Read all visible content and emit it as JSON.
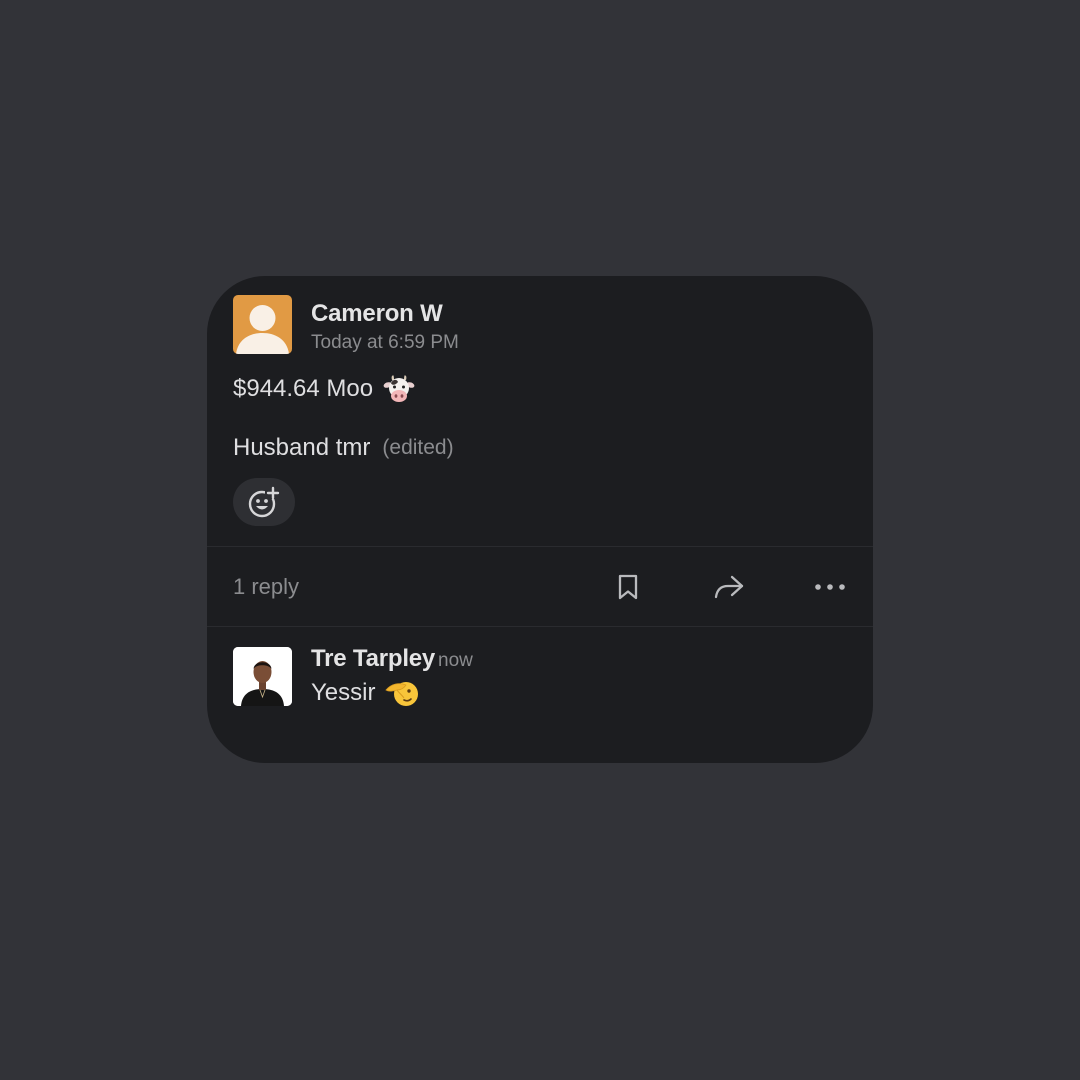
{
  "message": {
    "author": "Cameron W",
    "timestamp": "Today at 6:59 PM",
    "line1": "$944.64 Moo",
    "line1_emoji": "cow-face-icon",
    "line2": "Husband tmr",
    "edited_label": "(edited)",
    "avatar_color": "#e19a44"
  },
  "reaction": {
    "icon": "add-reaction-icon"
  },
  "thread": {
    "reply_count": "1 reply",
    "actions": [
      "bookmark-icon",
      "share-arrow-icon",
      "more-icon"
    ]
  },
  "reply": {
    "author": "Tre Tarpley",
    "timestamp": "now",
    "text": "Yessir",
    "emoji": "saluting-face-icon"
  },
  "colors": {
    "background": "#323338",
    "card": "#1c1d20",
    "text_primary": "#e4e4e5",
    "text_secondary": "#8b8c8f"
  }
}
